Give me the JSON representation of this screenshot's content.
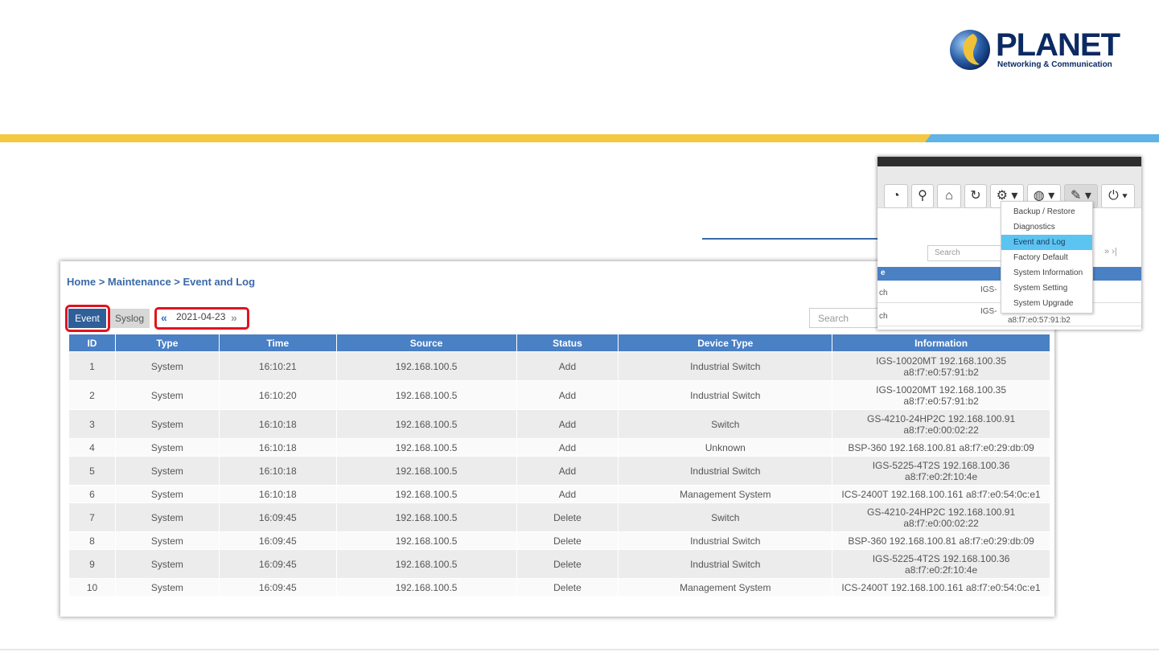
{
  "logo": {
    "brand": "PLANET",
    "tagline": "Networking & Communication"
  },
  "breadcrumb": "Home > Maintenance > Event and Log",
  "tabs": {
    "event": "Event",
    "syslog": "Syslog"
  },
  "date_nav": {
    "prev": "«",
    "date": "2021-04-23",
    "next": "»"
  },
  "search_placeholder": "Search",
  "table": {
    "headers": [
      "ID",
      "Type",
      "Time",
      "Source",
      "Status",
      "Device Type",
      "Information"
    ],
    "rows": [
      [
        "1",
        "System",
        "16:10:21",
        "192.168.100.5",
        "Add",
        "Industrial Switch",
        "IGS-10020MT 192.168.100.35",
        "a8:f7:e0:57:91:b2"
      ],
      [
        "2",
        "System",
        "16:10:20",
        "192.168.100.5",
        "Add",
        "Industrial Switch",
        "IGS-10020MT 192.168.100.35",
        "a8:f7:e0:57:91:b2"
      ],
      [
        "3",
        "System",
        "16:10:18",
        "192.168.100.5",
        "Add",
        "Switch",
        "GS-4210-24HP2C 192.168.100.91",
        "a8:f7:e0:00:02:22"
      ],
      [
        "4",
        "System",
        "16:10:18",
        "192.168.100.5",
        "Add",
        "Unknown",
        "BSP-360 192.168.100.81 a8:f7:e0:29:db:09",
        ""
      ],
      [
        "5",
        "System",
        "16:10:18",
        "192.168.100.5",
        "Add",
        "Industrial Switch",
        "IGS-5225-4T2S 192.168.100.36",
        "a8:f7:e0:2f:10:4e"
      ],
      [
        "6",
        "System",
        "16:10:18",
        "192.168.100.5",
        "Add",
        "Management System",
        "ICS-2400T 192.168.100.161 a8:f7:e0:54:0c:e1",
        ""
      ],
      [
        "7",
        "System",
        "16:09:45",
        "192.168.100.5",
        "Delete",
        "Switch",
        "GS-4210-24HP2C 192.168.100.91",
        "a8:f7:e0:00:02:22"
      ],
      [
        "8",
        "System",
        "16:09:45",
        "192.168.100.5",
        "Delete",
        "Industrial Switch",
        "BSP-360 192.168.100.81 a8:f7:e0:29:db:09",
        ""
      ],
      [
        "9",
        "System",
        "16:09:45",
        "192.168.100.5",
        "Delete",
        "Industrial Switch",
        "IGS-5225-4T2S 192.168.100.36",
        "a8:f7:e0:2f:10:4e"
      ],
      [
        "10",
        "System",
        "16:09:45",
        "192.168.100.5",
        "Delete",
        "Management System",
        "ICS-2400T 192.168.100.161 a8:f7:e0:54:0c:e1",
        ""
      ]
    ]
  },
  "inset": {
    "search_placeholder": "Search",
    "nav": "» ›|",
    "header_left": "e",
    "rows": [
      {
        "left": "ch",
        "right": "IGS-"
      },
      {
        "left": "ch",
        "right": "IGS-",
        "right2": "a8:f7:e0:57:91:b2"
      }
    ],
    "toolbar_icons": [
      "dashboard-icon",
      "location-icon",
      "topology-icon",
      "refresh-icon",
      "gear-icon",
      "globe-icon",
      "wrench-icon",
      "power-icon"
    ],
    "menu": [
      "Backup / Restore",
      "Diagnostics",
      "Event and Log",
      "Factory Default",
      "System Information",
      "System Setting",
      "System Upgrade"
    ],
    "active_menu": "Event and Log"
  },
  "colors": {
    "accent_blue": "#4a80c4",
    "highlight_red": "#e0141e",
    "menu_active": "#5cc4f0",
    "stripe_yellow": "#f5c842",
    "stripe_blue": "#5fb3e6"
  }
}
